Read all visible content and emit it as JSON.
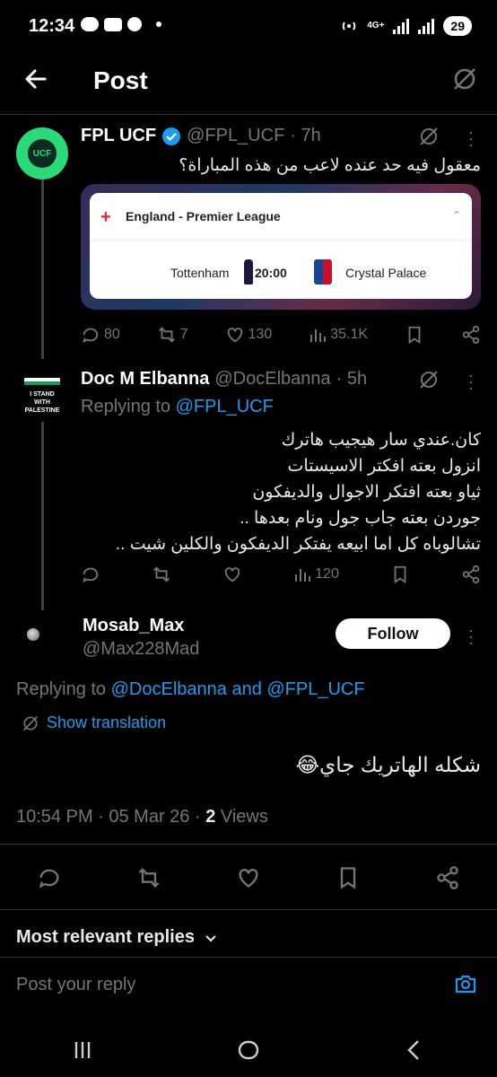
{
  "status_bar": {
    "time": "12:34",
    "network": "4G+",
    "battery": "29"
  },
  "header": {
    "title": "Post"
  },
  "tweet1": {
    "name": "FPL UCF",
    "handle": "@FPL_UCF",
    "time": "· 7h",
    "text": "معقول فيه حد عنده لاعب من هذه المباراة؟",
    "card": {
      "league": "England - Premier League",
      "home": "Tottenham",
      "kickoff": "20:00",
      "away": "Crystal Palace"
    },
    "avatar_text": "UCF",
    "stats": {
      "replies": "80",
      "retweets": "7",
      "likes": "130",
      "views": "35.1K"
    }
  },
  "tweet2": {
    "name": "Doc M Elbanna",
    "handle": "@DocElbanna",
    "time": "· 5h",
    "replying_prefix": "Replying to ",
    "replying_to": "@FPL_UCF",
    "avatar_text": [
      "I STAND",
      "WITH",
      "PALESTINE"
    ],
    "lines": [
      "كان.عندي سار هيجيب هاترك",
      "انزول بعته افكتر الاسيستات",
      "ثياو بعته افتكر الاجوال والديفكون",
      "جوردن بعته جاب جول ونام بعدها ..",
      "تشالوباه كل اما ابيعه يفتكر الديفكون والكلين شيت .."
    ],
    "stats": {
      "views": "120"
    }
  },
  "main": {
    "name": "Mosab_Max",
    "handle": "@Max228Mad",
    "follow_label": "Follow",
    "replying_prefix": "Replying to ",
    "replying_users": "@DocElbanna and @FPL_UCF",
    "show_translation": "Show translation",
    "text": "شكله الهاتريك جاي😂",
    "timestamp": "10:54 PM · 05 Mar 26 · ",
    "views_count": "2",
    "views_label": " Views"
  },
  "replies": {
    "sort_label": "Most relevant replies",
    "placeholder": "Post your reply"
  },
  "colors": {
    "accent": "#1d9bf0",
    "background": "#000000",
    "muted": "#71767b"
  }
}
